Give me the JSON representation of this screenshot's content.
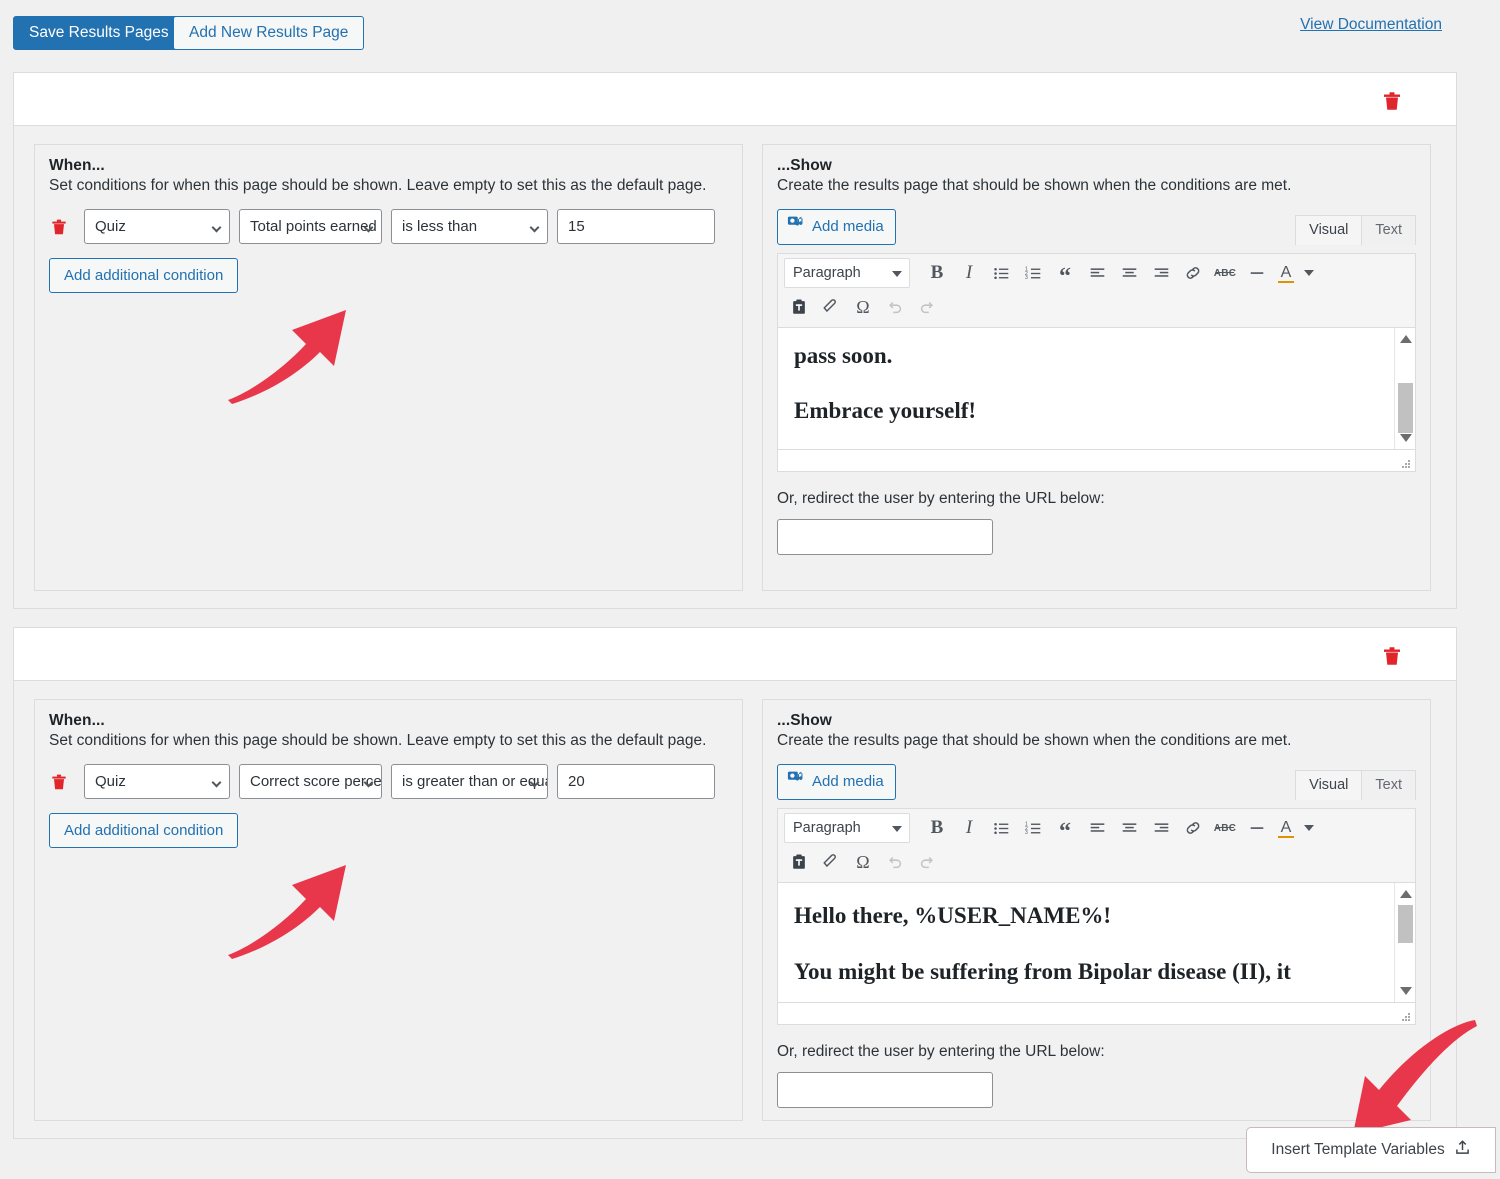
{
  "toolbar": {
    "save_label": "Save Results Pages",
    "add_new_label": "Add New Results Page",
    "doc_link_label": "View Documentation"
  },
  "icons": {
    "trash": "trash-icon",
    "add_media": "media-icon",
    "insert_template": "upload-icon"
  },
  "colors": {
    "primary": "#2271b1",
    "danger": "#e8374a",
    "panel_bg": "#f1f1f1",
    "page_bg": "#f0f0f1"
  },
  "common": {
    "when_title": "When...",
    "when_sub": "Set conditions for when this page should be shown. Leave empty to set this as the default page.",
    "show_title": "...Show",
    "show_sub": "Create the results page that should be shown when the conditions are met.",
    "add_condition_label": "Add additional condition",
    "add_media_label": "Add media",
    "tab_visual": "Visual",
    "tab_text": "Text",
    "paragraph_label": "Paragraph",
    "redirect_label": "Or, redirect the user by entering the URL below:",
    "url_value": "",
    "url_placeholder": ""
  },
  "editor_toolbar": {
    "row1": [
      "bold-icon",
      "italic-icon",
      "bulleted-list-icon",
      "numbered-list-icon",
      "blockquote-icon",
      "align-left-icon",
      "align-center-icon",
      "align-right-icon",
      "link-icon",
      "strikethrough-icon",
      "horizontal-rule-icon",
      "text-color-icon",
      "text-color-dropdown-icon"
    ],
    "row2": [
      "paste-as-text-icon",
      "clear-formatting-icon",
      "special-character-icon",
      "undo-icon",
      "redo-icon"
    ]
  },
  "panels": [
    {
      "condition": {
        "object": "Quiz",
        "property": "Total points earned",
        "operator": "is less than",
        "value": "15"
      },
      "editor_lines": [
        "pass soon.",
        "Embrace yourself!"
      ],
      "editor_clipped_top": true
    },
    {
      "condition": {
        "object": "Quiz",
        "property": "Correct score percentage",
        "operator": "is greater than or equal to",
        "value": "20"
      },
      "editor_lines": [
        "Hello there, %USER_NAME%!",
        "You might be suffering from Bipolar disease (II), it"
      ],
      "editor_clipped_bottom": true
    }
  ],
  "template_variables": {
    "label": "Insert Template Variables"
  },
  "annotations": [
    {
      "name": "arrow-to-condition-row-1",
      "direction": "up-right"
    },
    {
      "name": "arrow-to-condition-row-2",
      "direction": "up-right"
    },
    {
      "name": "arrow-to-insert-template-variables",
      "direction": "down-left"
    }
  ]
}
